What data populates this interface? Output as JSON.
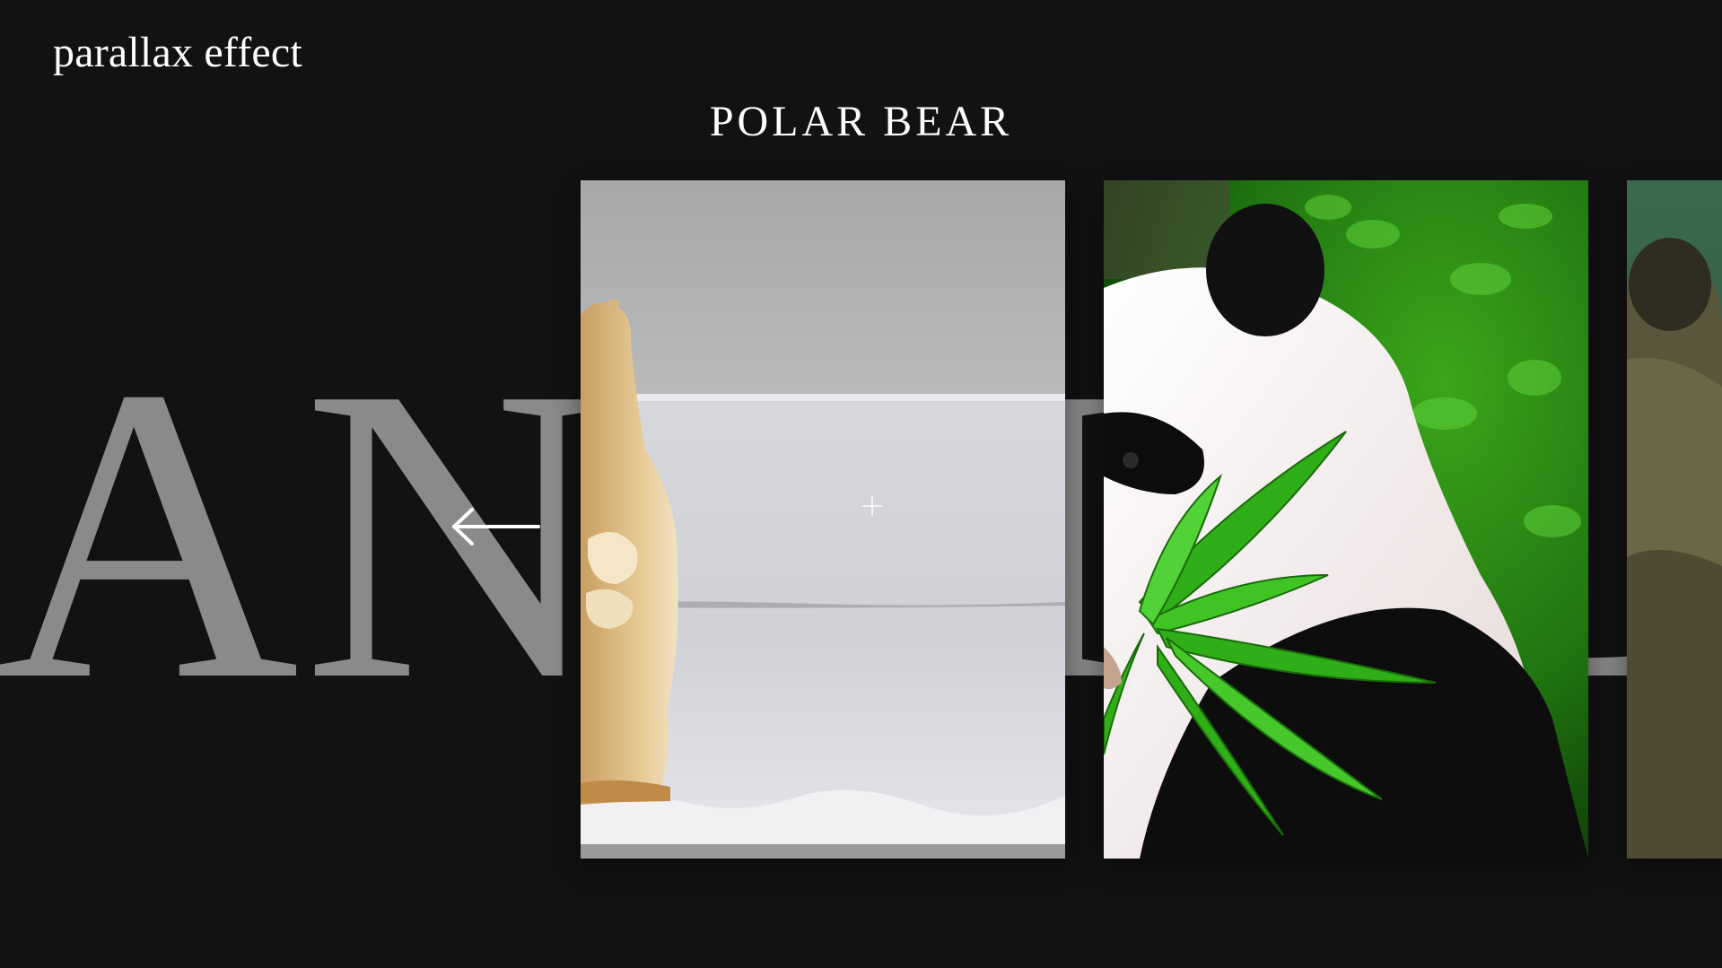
{
  "header": {
    "title": "parallax effect"
  },
  "slider": {
    "active_caption": "POLAR BEAR",
    "backdrop_word": "ANIMAL",
    "slides": [
      {
        "subject": "polar bear"
      },
      {
        "subject": "giant panda"
      },
      {
        "subject": "brown bear"
      }
    ],
    "prev_icon": "arrow-left-icon",
    "cursor_icon": "plus-icon"
  },
  "colors": {
    "background": "#121212",
    "text": "#ffffff",
    "backdrop_text": "#8a8a8a"
  }
}
